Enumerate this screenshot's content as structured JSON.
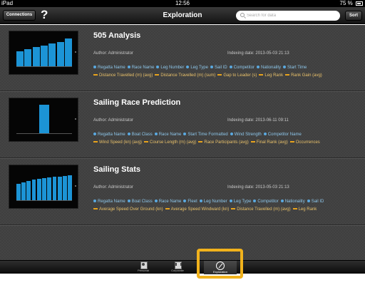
{
  "status_bar": {
    "device": "iPad",
    "time": "12:56",
    "battery": "75 %"
  },
  "nav": {
    "connections_label": "Connections",
    "help_label": "?",
    "title": "Exploration",
    "search_placeholder": "Search for data",
    "sort_label": "Sort"
  },
  "rows": [
    {
      "title": "505 Analysis",
      "author": "Author: Administrator",
      "date": "Indexing date: 2013-05-03  21:13",
      "dimensions": [
        "Regatta Name",
        "Race Name",
        "Leg Number",
        "Leg Type",
        "Sail ID",
        "Competitor",
        "Nationality",
        "Start Time"
      ],
      "measures": [
        "Distance Travelled (m) (avg)",
        "Distance Travelled (m) (sum)",
        "Gap to Leader (s)",
        "Leg Rank",
        "Rank Gain (avg)"
      ],
      "thumb": {
        "bars": [
          0.52,
          0.58,
          0.64,
          0.7,
          0.76,
          0.82,
          0.92
        ]
      }
    },
    {
      "title": "Sailing Race Prediction",
      "author": "Author: Administrator",
      "date": "Indexing date: 2013-06-11  09:11",
      "dimensions": [
        "Regatta Name",
        "Boat Class",
        "Race Name",
        "Start Time Formatted",
        "Wind Strength",
        "Competitor Name"
      ],
      "measures": [
        "Wind Speed (kn) (avg)",
        "Course Length (m) (avg)",
        "Race Participants (avg)",
        "Final Rank (avg)",
        "Occurrences"
      ],
      "thumb": {
        "bars": [
          0.95
        ]
      }
    },
    {
      "title": "Sailing Stats",
      "author": "Author: Administrator",
      "date": "Indexing date: 2013-05-03  21:13",
      "dimensions": [
        "Regatta Name",
        "Boat Class",
        "Race Name",
        "Fleet",
        "Leg Number",
        "Leg Type",
        "Competitor",
        "Nationality",
        "Sail ID"
      ],
      "measures": [
        "Average Speed Over Ground (kn)",
        "Average Speed Windward (kn)",
        "Distance Travelled (m) (avg)",
        "Leg Rank"
      ],
      "thumb": {
        "bars": [
          0.55,
          0.6,
          0.66,
          0.7,
          0.72,
          0.74,
          0.76,
          0.78,
          0.8,
          0.82,
          0.84
        ]
      }
    }
  ],
  "tabs": [
    {
      "label": "Personal",
      "icon": "person-icon"
    },
    {
      "label": "Corporate",
      "icon": "corporate-icon"
    },
    {
      "label": "Exploration",
      "icon": "compass-icon",
      "active": true
    }
  ],
  "colors": {
    "dimension": "#5aa9e0",
    "measure": "#e8a31c",
    "highlight": "#f1b21c",
    "bar": "#1c94d6"
  }
}
